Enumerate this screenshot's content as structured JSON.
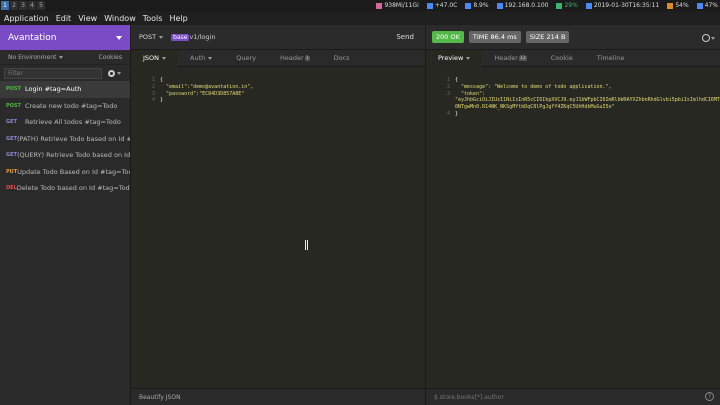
{
  "system_bar": {
    "workspaces": [
      "1",
      "2",
      "3",
      "4",
      "5"
    ],
    "memory": "938Mi/11Gi",
    "temperature": "+47.0C",
    "cpu": "8.9%",
    "ip": "192.168.0.100",
    "battery": "29%",
    "datetime": "2019-01-30T16:35:11",
    "brightness": "54%",
    "volume": "47%"
  },
  "menu": [
    "Application",
    "Edit",
    "View",
    "Window",
    "Tools",
    "Help"
  ],
  "sidebar": {
    "workspace_name": "Avantation",
    "environment": "No Environment",
    "cookies": "Cookies",
    "filter_placeholder": "Filter",
    "requests": [
      {
        "method": "POST",
        "name": "Login #tag=Auth",
        "selected": true
      },
      {
        "method": "POST",
        "name": "Create new todo #tag=Todo",
        "selected": false
      },
      {
        "method": "GET",
        "name": "Retrieve All todos #tag=Todo",
        "selected": false
      },
      {
        "method": "GET",
        "name": "(PATH) Retrieve Todo based on Id #...",
        "selected": false
      },
      {
        "method": "GET",
        "name": "(QUERY) Retrieve Todo based on Id...",
        "selected": false
      },
      {
        "method": "PUT",
        "name": "Update Todo Based on Id #tag=Todo",
        "selected": false
      },
      {
        "method": "DEL",
        "name": "Delete Todo based on Id #tag=Todo",
        "selected": false
      }
    ]
  },
  "request": {
    "method": "POST",
    "url_var": "base",
    "url_path": "v1/login",
    "send_label": "Send",
    "tabs": [
      {
        "label": "JSON",
        "active": true,
        "badge": ""
      },
      {
        "label": "Auth",
        "active": false,
        "badge": ""
      },
      {
        "label": "Query",
        "active": false,
        "badge": ""
      },
      {
        "label": "Header",
        "active": false,
        "badge": "1"
      },
      {
        "label": "Docs",
        "active": false,
        "badge": ""
      }
    ],
    "body_lines": [
      {
        "n": "1",
        "text": "{"
      },
      {
        "n": "2",
        "text": "  \"email\":\"demo@avantation.in\","
      },
      {
        "n": "3",
        "text": "  \"password\":\"EC84D3D857A8E\""
      },
      {
        "n": "4",
        "text": "}"
      }
    ],
    "beautify_label": "Beautify JSON"
  },
  "response": {
    "status": "200 OK",
    "time": "TIME 86.4 ms",
    "size": "SIZE 214 B",
    "tabs": [
      {
        "label": "Preview",
        "active": true,
        "badge": ""
      },
      {
        "label": "Header",
        "active": false,
        "badge": "12"
      },
      {
        "label": "Cookie",
        "active": false,
        "badge": ""
      },
      {
        "label": "Timeline",
        "active": false,
        "badge": ""
      }
    ],
    "body_lines": [
      {
        "n": "1",
        "text": "{"
      },
      {
        "n": "2",
        "text": "  \"message\": \"Welcome to demo of todo application.\","
      },
      {
        "n": "3",
        "text": "  \"token\":"
      },
      {
        "n": "",
        "text": "\"eyJhbGciOiJIUzI1NiIsInR5cCI6IkpXVCJ9.eyJ1bWFpbCI6ImRlbW9AYXZhbnRhdGlvbi5pbiIsImlhdCI6MTU0ODg"
      },
      {
        "n": "",
        "text": "0NTgwMn0.R14NK_NKSgMYtbDqC8lPgJgfY4ZKqC5UhHdbMuGuI5o\""
      },
      {
        "n": "4",
        "text": "}"
      }
    ],
    "filter_placeholder": "$.store.books[*].author"
  },
  "colors": {
    "workspace": "#7a4bc5",
    "status_ok": "#55b84a",
    "post": "#55b84a",
    "get": "#8b8bd8",
    "put": "#e2a03a",
    "delete": "#e05050"
  }
}
